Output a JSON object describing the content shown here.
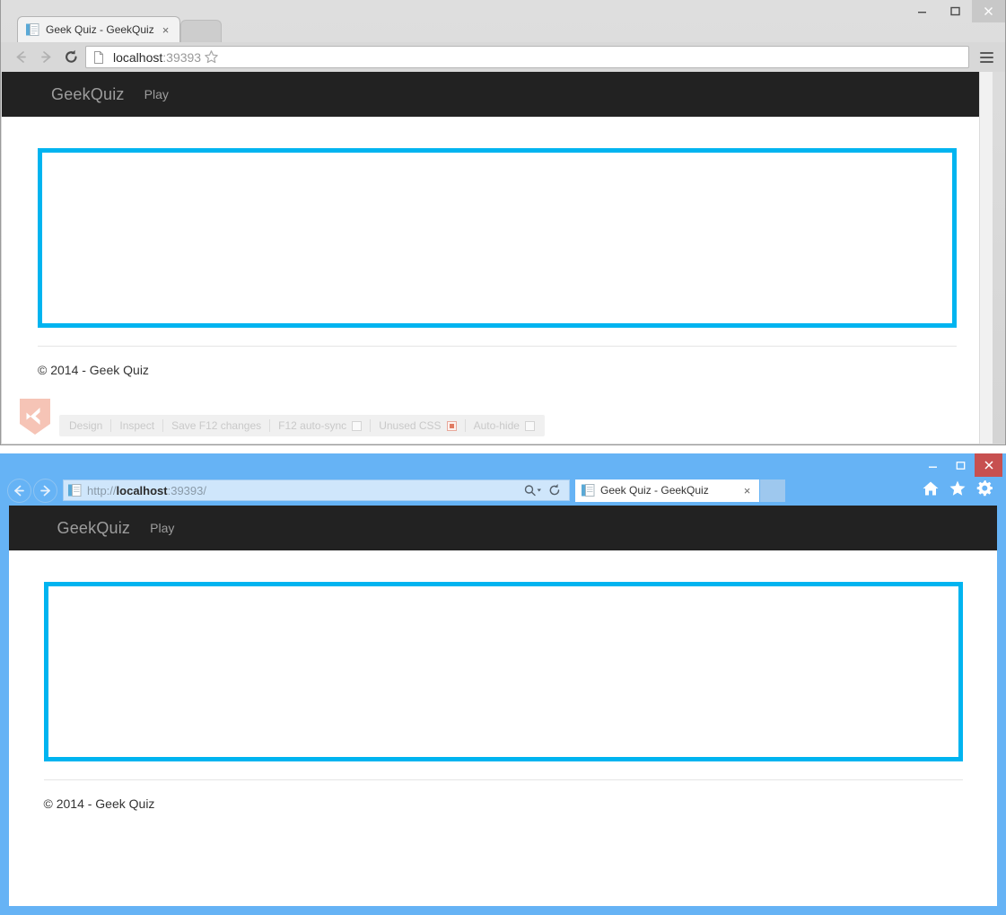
{
  "chrome_window": {
    "tab": {
      "title": "Geek Quiz - GeekQuiz",
      "close_label": "×"
    },
    "window_controls": {
      "minimize": "–",
      "maximize": "❐",
      "close": "✕"
    },
    "omnibox": {
      "value_host": "localhost",
      "value_port": ":39393",
      "full_value": "localhost:39393"
    },
    "nav": {
      "back": "back-arrow",
      "forward": "forward-arrow",
      "reload": "reload-arrow"
    },
    "browser_link": {
      "items": [
        {
          "label": "Design",
          "control": "none"
        },
        {
          "label": "Inspect",
          "control": "none"
        },
        {
          "label": "Save F12 changes",
          "control": "none"
        },
        {
          "label": "F12 auto-sync",
          "control": "checkbox"
        },
        {
          "label": "Unused CSS",
          "control": "radio"
        },
        {
          "label": "Auto-hide",
          "control": "checkbox"
        }
      ]
    }
  },
  "ie_window": {
    "window_controls": {
      "minimize": "–",
      "maximize": "❐",
      "close": "✕"
    },
    "address": {
      "scheme": "http://",
      "host": "localhost",
      "rest": ":39393/",
      "full_value": "http://localhost:39393/"
    },
    "tab": {
      "title": "Geek Quiz - GeekQuiz",
      "close_label": "×"
    },
    "toolbar_icons": [
      "home-icon",
      "favorites-star-icon",
      "settings-gear-icon"
    ]
  },
  "page": {
    "brand": "GeekQuiz",
    "navlink": "Play",
    "footer": "© 2014 - Geek Quiz",
    "panel_border_color": "#00b4f0",
    "navbar_color": "#222222"
  }
}
